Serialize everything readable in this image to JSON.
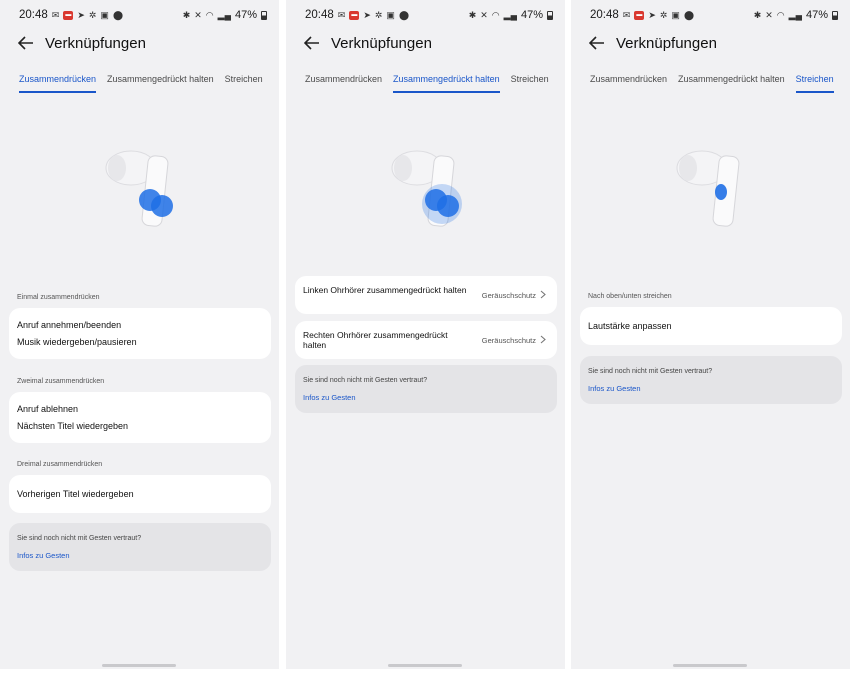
{
  "screens": [
    {
      "status": {
        "time": "20:48",
        "battery": "47%"
      },
      "title": "Verknüpfungen",
      "tabs": [
        "Zusammendrücken",
        "Zusammengedrückt halten",
        "Streichen"
      ],
      "active_tab": 0,
      "sections": [
        {
          "label": "Einmal zusammendrücken",
          "items": [
            "Anruf annehmen/beenden",
            "Musik wiedergeben/pausieren"
          ]
        },
        {
          "label": "Zweimal zusammendrücken",
          "items": [
            "Anruf ablehnen",
            "Nächsten Titel wiedergeben"
          ]
        },
        {
          "label": "Dreimal zusammendrücken",
          "items": [
            "Vorherigen Titel wiedergeben"
          ]
        }
      ],
      "info": {
        "text": "Sie sind noch nicht mit Gesten vertraut?",
        "link": "Infos zu Gesten"
      }
    },
    {
      "status": {
        "time": "20:48",
        "battery": "47%"
      },
      "title": "Verknüpfungen",
      "tabs": [
        "Zusammendrücken",
        "Zusammengedrückt halten",
        "Streichen"
      ],
      "active_tab": 1,
      "settings": [
        {
          "label": "Linken Ohrhörer zusammengedrückt halten",
          "value": "Geräuschschutz"
        },
        {
          "label": "Rechten Ohrhörer zusammengedrückt halten",
          "value": "Geräuschschutz"
        }
      ],
      "info": {
        "text": "Sie sind noch nicht mit Gesten vertraut?",
        "link": "Infos zu Gesten"
      }
    },
    {
      "status": {
        "time": "20:48",
        "battery": "47%"
      },
      "title": "Verknüpfungen",
      "tabs": [
        "Zusammendrücken",
        "Zusammengedrückt halten",
        "Streichen"
      ],
      "active_tab": 2,
      "sections": [
        {
          "label": "Nach oben/unten streichen",
          "items": [
            "Lautstärke anpassen"
          ]
        }
      ],
      "info": {
        "text": "Sie sind noch nicht mit Gesten vertraut?",
        "link": "Infos zu Gesten"
      }
    }
  ],
  "colors": {
    "accent": "#1a56c9",
    "background": "#f1f1f3",
    "card": "#ffffff",
    "info_card": "#e4e4e7",
    "gesture_dot": "#1f6fe5"
  },
  "icons": [
    "back-arrow-icon",
    "bluetooth-icon",
    "mute-icon",
    "wifi-icon",
    "signal-icon",
    "battery-icon",
    "chevron-right-icon",
    "earbud-image"
  ]
}
